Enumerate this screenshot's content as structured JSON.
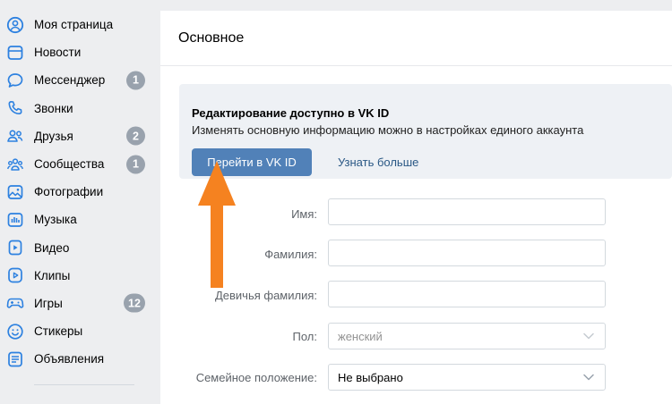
{
  "sidebar": {
    "items": [
      {
        "key": "profile",
        "label": "Моя страница",
        "icon": "user-circle-icon"
      },
      {
        "key": "news",
        "label": "Новости",
        "icon": "news-feed-icon"
      },
      {
        "key": "messenger",
        "label": "Мессенджер",
        "icon": "message-bubble-icon",
        "badge": "1"
      },
      {
        "key": "calls",
        "label": "Звонки",
        "icon": "phone-icon"
      },
      {
        "key": "friends",
        "label": "Друзья",
        "icon": "friends-icon",
        "badge": "2"
      },
      {
        "key": "communities",
        "label": "Сообщества",
        "icon": "communities-icon",
        "badge": "1"
      },
      {
        "key": "photos",
        "label": "Фотографии",
        "icon": "photo-icon"
      },
      {
        "key": "music",
        "label": "Музыка",
        "icon": "music-icon"
      },
      {
        "key": "video",
        "label": "Видео",
        "icon": "video-icon"
      },
      {
        "key": "clips",
        "label": "Клипы",
        "icon": "clips-icon"
      },
      {
        "key": "games",
        "label": "Игры",
        "icon": "gamepad-icon",
        "badge": "12"
      },
      {
        "key": "stickers",
        "label": "Стикеры",
        "icon": "sticker-icon"
      },
      {
        "key": "ads",
        "label": "Объявления",
        "icon": "classifieds-icon"
      }
    ]
  },
  "main": {
    "title": "Основное",
    "notice": {
      "title": "Редактирование доступно в VK ID",
      "text": "Изменять основную информацию можно в настройках единого аккаунта",
      "button": "Перейти в VK ID",
      "link": "Узнать больше"
    },
    "form": {
      "first_name_label": "Имя:",
      "first_name_value": "",
      "last_name_label": "Фамилия:",
      "last_name_value": "",
      "maiden_name_label": "Девичья фамилия:",
      "maiden_name_value": "",
      "gender_label": "Пол:",
      "gender_value": "женский",
      "marital_label": "Семейное положение:",
      "marital_value": "Не выбрано"
    }
  },
  "colors": {
    "accent": "#5181b8",
    "link": "#2a5885",
    "badge": "#99a2ad",
    "icon": "#2d81e0",
    "arrow": "#f58220",
    "page_bg": "#edeef0"
  }
}
